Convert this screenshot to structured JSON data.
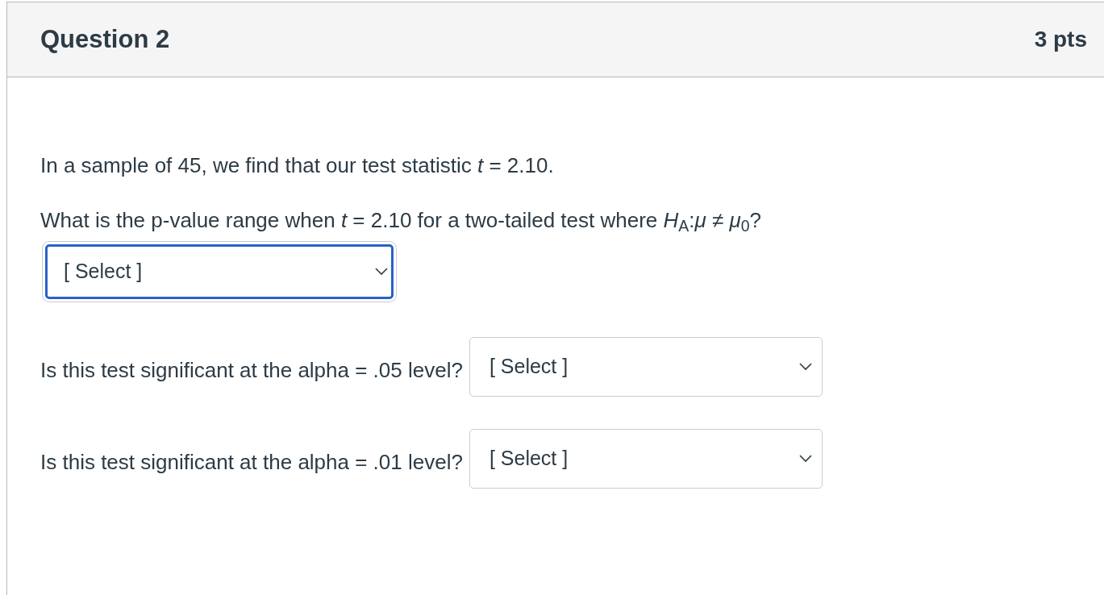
{
  "question": {
    "title": "Question 2",
    "points": "3 pts"
  },
  "intro": "In a sample of 45, we find that our test statistic *t* = 2.10.",
  "items": [
    {
      "kind": "block",
      "prompt": "What is the p-value range when *t* = 2.10 for a two-tailed test where *H*$_{A}$:*μ* ≠ *μ*$_{0}$?",
      "dropdown": {
        "placeholder": "[ Select ]",
        "focused": true
      }
    },
    {
      "kind": "inline",
      "prompt": "Is this test significant at the alpha = .05 level?",
      "dropdown": {
        "placeholder": "[ Select ]",
        "focused": false
      }
    },
    {
      "kind": "inline",
      "prompt": "Is this test significant at the alpha = .01 level?",
      "dropdown": {
        "placeholder": "[ Select ]",
        "focused": false
      }
    }
  ]
}
